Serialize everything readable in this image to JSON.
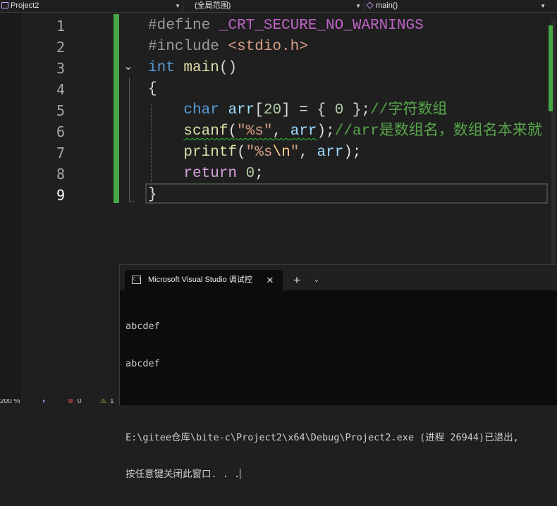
{
  "navbar": {
    "project": "Project2",
    "scope": "(全局范围)",
    "member": "main()"
  },
  "icons": {
    "project": "project-icon",
    "member": "cube-icon",
    "fold": "fold-chevron-icon",
    "terminal": "terminal-icon",
    "close": "close-icon",
    "new_tab": "plus-icon",
    "dropdown": "chevron-down-icon"
  },
  "editor": {
    "line_numbers": [
      "1",
      "2",
      "3",
      "4",
      "5",
      "6",
      "7",
      "8",
      "9"
    ],
    "current_line": "9",
    "lines": [
      {
        "tokens": [
          {
            "t": "#define ",
            "c": "dir"
          },
          {
            "t": "_CRT_SECURE_NO_WARNINGS",
            "c": "macro"
          }
        ]
      },
      {
        "tokens": [
          {
            "t": "#include ",
            "c": "dir"
          },
          {
            "t": "<stdio.h>",
            "c": "str"
          }
        ]
      },
      {
        "tokens": [
          {
            "t": "int ",
            "c": "kw"
          },
          {
            "t": "main",
            "c": "fn"
          },
          {
            "t": "()",
            "c": "plain"
          }
        ]
      },
      {
        "tokens": [
          {
            "t": "{",
            "c": "plain"
          }
        ]
      },
      {
        "tokens": [
          {
            "t": "    ",
            "c": "plain"
          },
          {
            "t": "char ",
            "c": "kw"
          },
          {
            "t": "arr",
            "c": "var"
          },
          {
            "t": "[",
            "c": "plain"
          },
          {
            "t": "20",
            "c": "num"
          },
          {
            "t": "] = { ",
            "c": "plain"
          },
          {
            "t": "0",
            "c": "num"
          },
          {
            "t": " };",
            "c": "plain"
          },
          {
            "t": "//字符数组",
            "c": "cmt"
          }
        ]
      },
      {
        "tokens": [
          {
            "t": "    ",
            "c": "plain"
          },
          {
            "t": "scanf",
            "c": "fn squig"
          },
          {
            "t": "(",
            "c": "plain squig"
          },
          {
            "t": "\"%s\"",
            "c": "str squig"
          },
          {
            "t": ", ",
            "c": "plain squig"
          },
          {
            "t": "arr",
            "c": "var squig"
          },
          {
            "t": ");",
            "c": "plain"
          },
          {
            "t": "//arr是数组名，数组名本来就",
            "c": "cmt"
          }
        ]
      },
      {
        "tokens": [
          {
            "t": "    ",
            "c": "plain"
          },
          {
            "t": "printf",
            "c": "fn"
          },
          {
            "t": "(",
            "c": "plain"
          },
          {
            "t": "\"%s",
            "c": "str"
          },
          {
            "t": "\\n",
            "c": "esc"
          },
          {
            "t": "\"",
            "c": "str"
          },
          {
            "t": ", ",
            "c": "plain"
          },
          {
            "t": "arr",
            "c": "var"
          },
          {
            "t": ");",
            "c": "plain"
          }
        ]
      },
      {
        "tokens": [
          {
            "t": "    ",
            "c": "plain"
          },
          {
            "t": "return ",
            "c": "ctl"
          },
          {
            "t": "0",
            "c": "num"
          },
          {
            "t": ";",
            "c": "plain"
          }
        ]
      },
      {
        "tokens": [
          {
            "t": "}",
            "c": "plain"
          }
        ]
      }
    ]
  },
  "status": {
    "zoom": "200 %",
    "errors": "0",
    "warnings": "1"
  },
  "terminal": {
    "tab_title": "Microsoft Visual Studio 调试控",
    "close_glyph": "✕",
    "new_tab_glyph": "+",
    "dropdown_glyph": "⌄",
    "output_lines": [
      "abcdef",
      "abcdef",
      "",
      "E:\\gitee仓库\\bite-c\\Project2\\x64\\Debug\\Project2.exe (进程 26944)已退出,",
      "按任意键关闭此窗口. . ."
    ]
  },
  "colors": {
    "change_bar": "#45a845",
    "editor_bg": "#1f1f1f",
    "terminal_bg": "#0c0c0c"
  }
}
